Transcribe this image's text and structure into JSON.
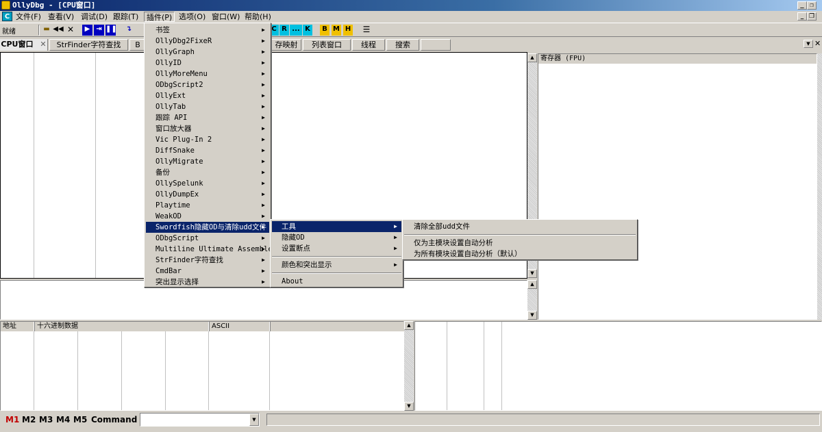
{
  "window": {
    "title": "OllyDbg - [CPU窗口]"
  },
  "menubar": {
    "items": [
      "文件(F)",
      "查看(V)",
      "调试(D)",
      "跟踪(T)",
      "插件(P)",
      "选项(O)",
      "窗口(W)",
      "帮助(H)"
    ]
  },
  "toolbar": {
    "status": "就绪",
    "letter_buttons": [
      "C",
      "R",
      "...",
      "K",
      "B",
      "M",
      "H"
    ]
  },
  "tabs": [
    "CPU窗口",
    "StrFinder字符查找",
    "B",
    "存映射",
    "列表窗口",
    "线程",
    "搜索"
  ],
  "panes": {
    "registers_header": "寄存器 (FPU)",
    "dump_headers": [
      "地址",
      "十六进制数据",
      "ASCII"
    ]
  },
  "plugin_menu": {
    "items": [
      "书签",
      "OllyDbg2FixeR",
      "OllyGraph",
      "OllyID",
      "OllyMoreMenu",
      "ODbgScript2",
      "OllyExt",
      "OllyTab",
      "跟踪 API",
      "窗口放大器",
      "Vic Plug-In 2",
      "DiffSnake",
      "OllyMigrate",
      "备份",
      "OllySpelunk",
      "OllyDumpEx",
      "Playtime",
      "WeakOD",
      "Swordfish隐藏OD与清除udd文件",
      "ODbgScript",
      "Multiline Ultimate Assembler",
      "StrFinder字符查找",
      "CmdBar",
      "突出显示选择"
    ],
    "highlighted_index": 18
  },
  "swordfish_submenu": {
    "items": [
      "工具",
      "隐藏OD",
      "设置断点",
      "颜色和突出显示",
      "About"
    ],
    "highlighted_index": 0
  },
  "tools_submenu": {
    "items": [
      "清除全部udd文件",
      "仅为主模块设置自动分析",
      "为所有模块设置自动分析（默认）"
    ]
  },
  "statusbar": {
    "marks": [
      "M1",
      "M2",
      "M3",
      "M4",
      "M5"
    ],
    "command_label": "Command :",
    "command_value": ""
  },
  "colors": {
    "title_start": "#0a246a",
    "highlight": "#0a246a",
    "m1": "#c00000",
    "face": "#d4d0c8"
  }
}
